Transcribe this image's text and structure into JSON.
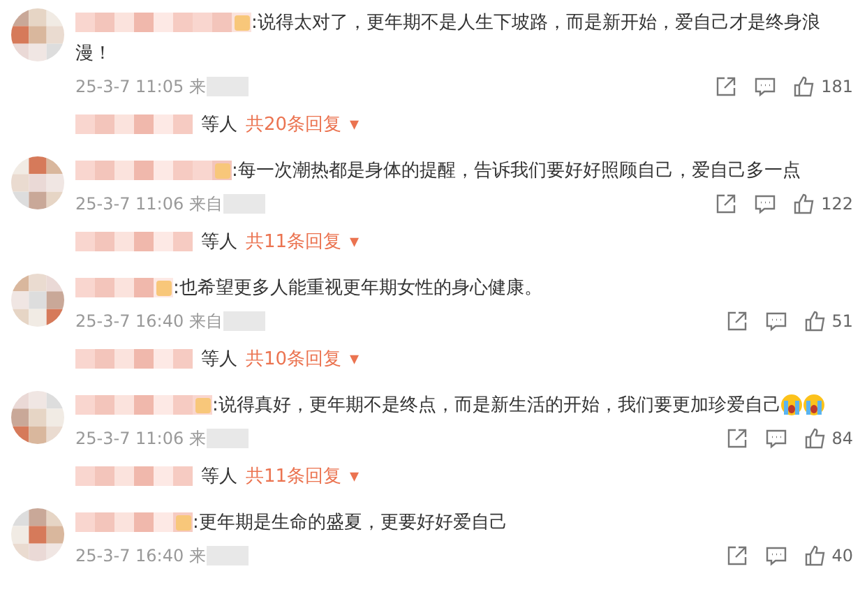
{
  "comments": [
    {
      "lines": [
        ":说得太对了，更年期不是人生下坡路，而是新开始，爱自己才是终身浪",
        "漫！"
      ],
      "time": "25-3-7 11:05",
      "source": "来",
      "likes": "181",
      "replies": {
        "who": "等人",
        "count": "共20条回复",
        "caret": "▾"
      }
    },
    {
      "lines": [
        ":每一次潮热都是身体的提醒，告诉我们要好好照顾自己，爱自己多一点"
      ],
      "time": "25-3-7 11:06",
      "source": "来自",
      "likes": "122",
      "replies": {
        "who": "等人",
        "count": "共11条回复",
        "caret": "▾"
      }
    },
    {
      "lines": [
        ":也希望更多人能重视更年期女性的身心健康。"
      ],
      "time": "25-3-7 16:40",
      "source": "来自",
      "likes": "51",
      "replies": {
        "who": "等人",
        "count": "共10条回复",
        "caret": "▾"
      }
    },
    {
      "lines": [
        ":说得真好，更年期不是终点，而是新生活的开始，我们要更加珍爱自己"
      ],
      "emojis": [
        {
          "kind": "crying"
        },
        {
          "kind": "crying"
        }
      ],
      "time": "25-3-7 11:06",
      "source": "来",
      "likes": "84",
      "replies": {
        "who": "等人",
        "count": "共11条回复",
        "caret": "▾"
      }
    },
    {
      "lines": [
        ":更年期是生命的盛夏，更要好好爱自己"
      ],
      "time": "25-3-7 16:40",
      "source": "来",
      "likes": "40"
    }
  ]
}
